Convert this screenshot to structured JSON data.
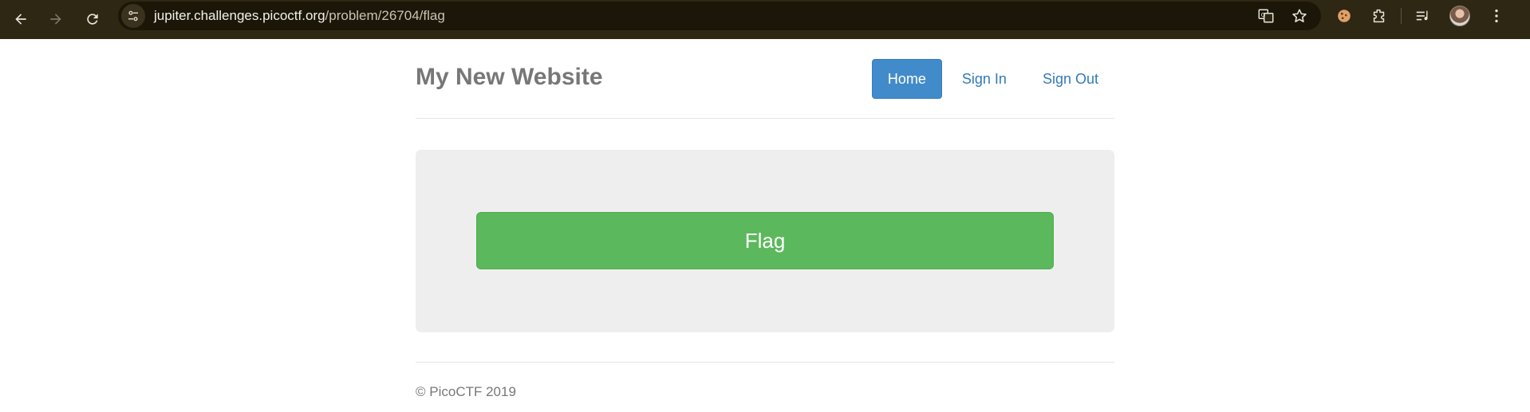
{
  "browser": {
    "url_host": "jupiter.challenges.picoctf.org",
    "url_path": "/problem/26704/flag",
    "icons": {
      "back": "arrow-left-icon",
      "forward": "arrow-right-icon",
      "reload": "reload-icon",
      "site_info": "tune-icon",
      "translate": "translate-icon",
      "bookmark": "star-icon",
      "extension1": "cookie-icon",
      "extensions": "puzzle-icon",
      "reading_list": "playlist-icon",
      "profile": "avatar",
      "menu": "kebab-menu-icon"
    },
    "colors": {
      "chrome_bg": "#2e2714",
      "omnibox_bg": "#1b1608"
    }
  },
  "page": {
    "brand": "My New Website",
    "nav": [
      {
        "label": "Home",
        "active": true
      },
      {
        "label": "Sign In",
        "active": false
      },
      {
        "label": "Sign Out",
        "active": false
      }
    ],
    "flag_button": "Flag",
    "footer": "© PicoCTF 2019",
    "colors": {
      "primary": "#428bca",
      "link": "#337ab7",
      "success": "#5cb85c",
      "jumbotron": "#eeeeee"
    }
  }
}
